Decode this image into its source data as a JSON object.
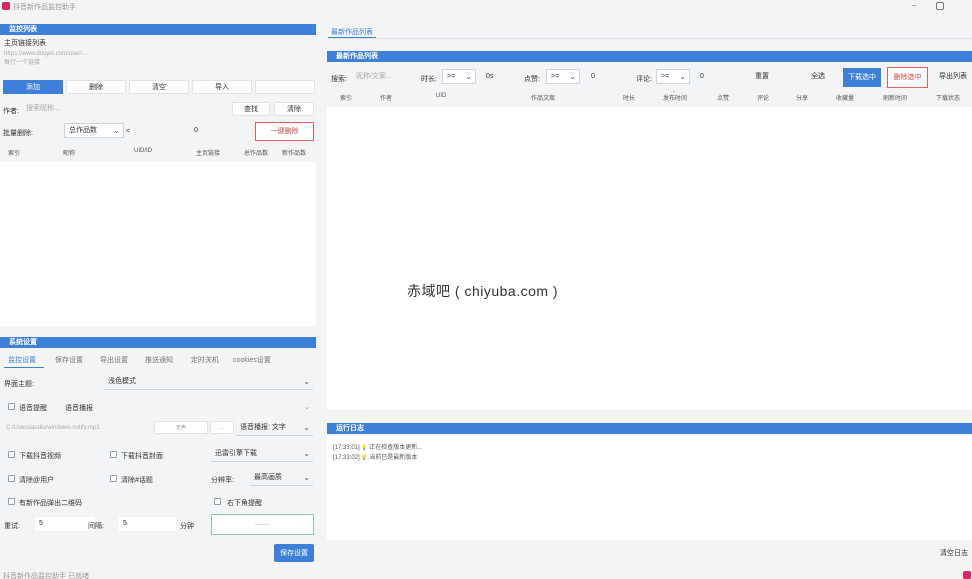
{
  "window": {
    "title": "抖音新作品监控助手"
  },
  "left_panel": {
    "monitor_header": "监控列表",
    "homepage_label": "主页链接列表",
    "homepage_placeholder": "https://www.douyin.com/user/...",
    "homepage_hint": "每行一个链接",
    "actions": {
      "add": "添加",
      "delete": "删除",
      "clear": "清空",
      "import": "导入"
    },
    "author_label": "作者:",
    "author_placeholder": "搜索昵称...",
    "find": "查找",
    "clear_search": "清除",
    "batch_label": "批量删除:",
    "batch_select": "总作品数",
    "batch_op": "<",
    "batch_value": "0",
    "one_click_delete": "一键删除",
    "table_headers": [
      "索引",
      "昵称",
      "UID/ID",
      "主页链接",
      "总作品数",
      "新作品数"
    ]
  },
  "settings": {
    "header": "系统设置",
    "tabs": [
      "监控设置",
      "保存设置",
      "导出设置",
      "推送通知",
      "定时关机",
      "cookies设置"
    ],
    "theme_label": "界面主题:",
    "theme_value": "浅色模式",
    "sound_alert": "语音提醒",
    "voice_broadcast": "语音播报",
    "sound_path_placeholder": "C:/Users/audio/windows-notify.mp3",
    "cell_a": "无声",
    "cell_b": "...",
    "broadcast_label": "语音播报: 文字",
    "download_watermark": "下载抖音视频",
    "download_cover": "下载抖音封面",
    "engine_value": "迅雷引擎下载",
    "remove_at": "清除@用户",
    "remove_topic": "清除#话题",
    "resolution_label": "分辨率:",
    "resolution_value": "最高画质",
    "new_work_qr": "有新作品弹出二维码",
    "corner_alert": "右下角提醒",
    "retry_label": "重试:",
    "retry_value": "5",
    "interval_label": "间隔:",
    "interval_value": "5",
    "minutes_label": "分钟",
    "start_button": "---------",
    "save_button": "保存设置"
  },
  "right_panel": {
    "tab": "最新作品列表",
    "header": "最新作品列表",
    "filters": {
      "search_label": "搜索:",
      "search_placeholder": "昵称/文案...",
      "duration_label": "时长:",
      "duration_op": ">=",
      "duration_value": "0s",
      "likes_label": "点赞:",
      "likes_op": ">=",
      "likes_value": "0",
      "comments_label": "评论:",
      "comments_op": ">=",
      "comments_value": "0",
      "reset": "重置",
      "select_all": "全选",
      "download_selected": "下载选中",
      "delete_selected": "删除选中",
      "export_list": "导出列表"
    },
    "table_headers": [
      "索引",
      "作者",
      "UID",
      "作品文案",
      "时长",
      "发布时间",
      "点赞",
      "评论",
      "分享",
      "收藏量",
      "刷新时间",
      "下载状态"
    ],
    "watermark": "赤域吧 ( chiyuba.com )"
  },
  "log": {
    "header": "运行日志",
    "lines": [
      {
        "time": "[17:33:01]",
        "icon": "💡",
        "text": "正在检查版本更新..."
      },
      {
        "time": "[17:33:02]",
        "icon": "💡",
        "text": "当前已是最新版本"
      }
    ],
    "clear_log": "清空日志"
  },
  "statusbar": {
    "text": "抖音新作品监控助手 已就绪"
  }
}
